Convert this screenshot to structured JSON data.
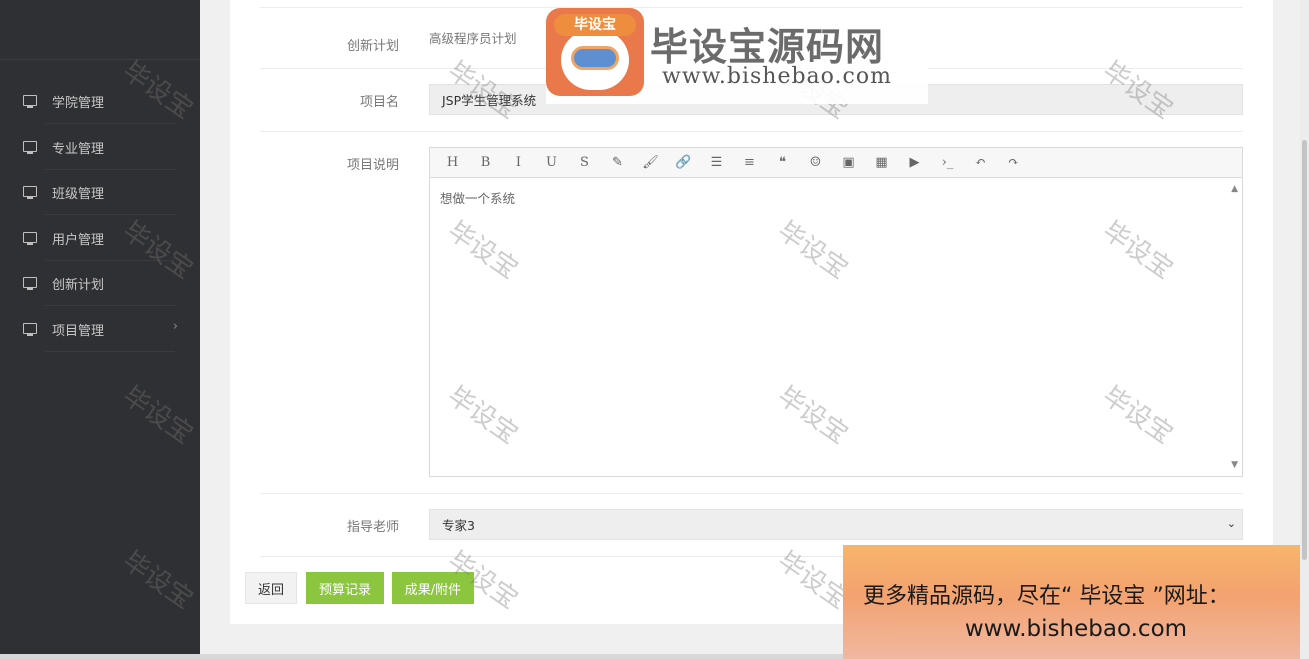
{
  "sidebar": {
    "items": [
      {
        "label": "学院管理",
        "icon": "monitor-icon"
      },
      {
        "label": "专业管理",
        "icon": "monitor-icon"
      },
      {
        "label": "班级管理",
        "icon": "monitor-icon"
      },
      {
        "label": "用户管理",
        "icon": "monitor-icon"
      },
      {
        "label": "创新计划",
        "icon": "monitor-icon"
      },
      {
        "label": "项目管理",
        "icon": "monitor-icon",
        "chevron": "›"
      }
    ]
  },
  "form": {
    "plan_label": "创新计划",
    "plan_value": "高级程序员计划",
    "name_label": "项目名",
    "name_value": "JSP学生管理系统",
    "desc_label": "项目说明",
    "desc_value": "想做一个系统",
    "teacher_label": "指导老师",
    "teacher_value": "专家3",
    "teacher_arrow": "⌄"
  },
  "toolbar": {
    "buttons": [
      {
        "glyph": "H",
        "icon": "heading-icon"
      },
      {
        "glyph": "B",
        "icon": "bold-icon"
      },
      {
        "glyph": "I",
        "icon": "italic-icon"
      },
      {
        "glyph": "U",
        "icon": "underline-icon"
      },
      {
        "glyph": "S",
        "icon": "strikethrough-icon"
      },
      {
        "glyph": "✎",
        "icon": "pencil-icon"
      },
      {
        "glyph": "🖌",
        "icon": "brush-icon"
      },
      {
        "glyph": "🔗",
        "icon": "link-icon"
      },
      {
        "glyph": "☰",
        "icon": "list-icon"
      },
      {
        "glyph": "≡",
        "icon": "align-icon"
      },
      {
        "glyph": "❝",
        "icon": "quote-icon"
      },
      {
        "glyph": "☺",
        "icon": "emoji-icon"
      },
      {
        "glyph": "▣",
        "icon": "image-icon"
      },
      {
        "glyph": "▦",
        "icon": "table-icon"
      },
      {
        "glyph": "▶",
        "icon": "video-icon"
      },
      {
        "glyph": "›_",
        "icon": "code-icon"
      },
      {
        "glyph": "↶",
        "icon": "undo-icon"
      },
      {
        "glyph": "↷",
        "icon": "redo-icon"
      }
    ]
  },
  "actions": {
    "back": "返回",
    "budget": "预算记录",
    "results": "成果/附件"
  },
  "logo": {
    "badge": "毕设宝",
    "title": "毕设宝源码网",
    "url": "www.bishebao.com"
  },
  "watermark": "毕设宝",
  "promo": {
    "line1": "更多精品源码，尽在“ 毕设宝 ”网址：",
    "line2": "www.bishebao.com"
  },
  "colors": {
    "sidebar_bg": "#2f3033",
    "accent_green": "#8cc63f",
    "promo_orange": "#f3a270"
  }
}
